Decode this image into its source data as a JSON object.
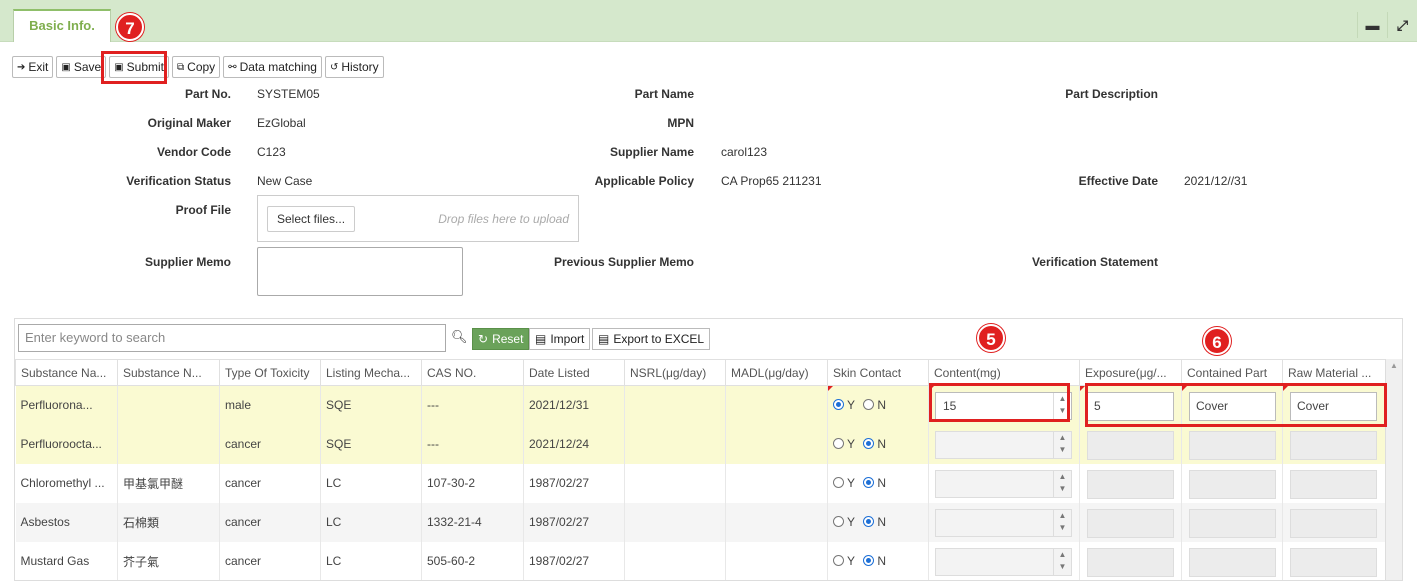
{
  "tab": {
    "label": "Basic Info."
  },
  "window": {
    "minimize": "▬",
    "maximize": "⤢"
  },
  "markers": {
    "m7": "7",
    "m5": "5",
    "m6": "6"
  },
  "toolbar": {
    "exit": "Exit",
    "save": "Save",
    "submit": "Submit",
    "copy": "Copy",
    "data_matching": "Data matching",
    "history": "History"
  },
  "form": {
    "part_no_label": "Part No.",
    "part_no": "SYSTEM05",
    "part_name_label": "Part Name",
    "part_desc_label": "Part Description",
    "original_maker_label": "Original Maker",
    "original_maker": "EzGlobal",
    "mpn_label": "MPN",
    "vendor_code_label": "Vendor Code",
    "vendor_code": "C123",
    "supplier_name_label": "Supplier Name",
    "supplier_name": "carol123",
    "verification_status_label": "Verification Status",
    "verification_status": "New Case",
    "applicable_policy_label": "Applicable Policy",
    "applicable_policy": "CA Prop65 211231",
    "effective_date_label": "Effective Date",
    "effective_date": "2021/12//31",
    "proof_file_label": "Proof File",
    "select_files": "Select files...",
    "drop_hint": "Drop files here to upload",
    "supplier_memo_label": "Supplier Memo",
    "prev_supplier_memo_label": "Previous Supplier Memo",
    "verification_statement_label": "Verification Statement"
  },
  "grid": {
    "search_placeholder": "Enter keyword to search",
    "reset": "Reset",
    "import": "Import",
    "export": "Export to EXCEL",
    "columns": [
      "Substance Na...",
      "Substance N...",
      "Type Of Toxicity",
      "Listing Mecha...",
      "CAS NO.",
      "Date Listed",
      "NSRL(μg/day)",
      "MADL(μg/day)",
      "Skin Contact",
      "Content(mg)",
      "Exposure(μg/...",
      "Contained Part",
      "Raw Material ..."
    ],
    "radio_y": "Y",
    "radio_n": "N",
    "rows": [
      {
        "name": "Perfluorona...",
        "name2": "",
        "toxicity": "male",
        "listing": "SQE",
        "cas": "---",
        "date": "2021/12/31",
        "nsrl": "",
        "madl": "",
        "skin": "Y",
        "content": "15",
        "exposure": "5",
        "part": "Cover",
        "raw": "Cover"
      },
      {
        "name": "Perfluoroocta...",
        "name2": "",
        "toxicity": "cancer",
        "listing": "SQE",
        "cas": "---",
        "date": "2021/12/24",
        "nsrl": "",
        "madl": "",
        "skin": "N",
        "content": "",
        "exposure": "",
        "part": "",
        "raw": ""
      },
      {
        "name": "Chloromethyl ...",
        "name2": "甲基氯甲醚",
        "toxicity": "cancer",
        "listing": "LC",
        "cas": "107-30-2",
        "date": "1987/02/27",
        "nsrl": "",
        "madl": "",
        "skin": "N",
        "content": "",
        "exposure": "",
        "part": "",
        "raw": ""
      },
      {
        "name": "Asbestos",
        "name2": "石棉類",
        "toxicity": "cancer",
        "listing": "LC",
        "cas": "1332-21-4",
        "date": "1987/02/27",
        "nsrl": "",
        "madl": "",
        "skin": "N",
        "content": "",
        "exposure": "",
        "part": "",
        "raw": ""
      },
      {
        "name": "Mustard Gas",
        "name2": "芥子氣",
        "toxicity": "cancer",
        "listing": "LC",
        "cas": "505-60-2",
        "date": "1987/02/27",
        "nsrl": "",
        "madl": "",
        "skin": "N",
        "content": "",
        "exposure": "",
        "part": "",
        "raw": ""
      }
    ]
  }
}
